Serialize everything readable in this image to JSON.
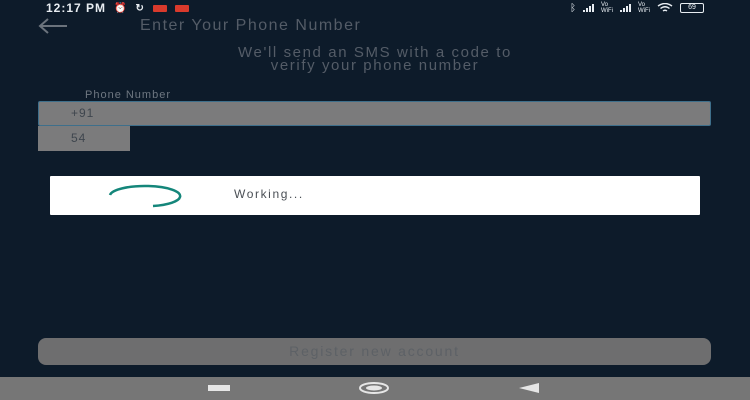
{
  "status_bar": {
    "time": "12:17 PM",
    "net1": "Vo\nWiFi",
    "net2": "Vo\nWiFi",
    "battery": "69"
  },
  "header": {
    "title": "Enter Your Phone Number"
  },
  "subtitle": {
    "line1": "We'll send an SMS with a code to",
    "line2": "verify your phone number"
  },
  "phone": {
    "label": "Phone Number",
    "value": "+91",
    "code": "54"
  },
  "dialog": {
    "text": "Working..."
  },
  "register": {
    "label": "Register new account"
  },
  "colors": {
    "background": "#0d1b2a",
    "spinner": "#14867a",
    "field_border": "#3e6f8b",
    "notification": "#d93a2c"
  }
}
